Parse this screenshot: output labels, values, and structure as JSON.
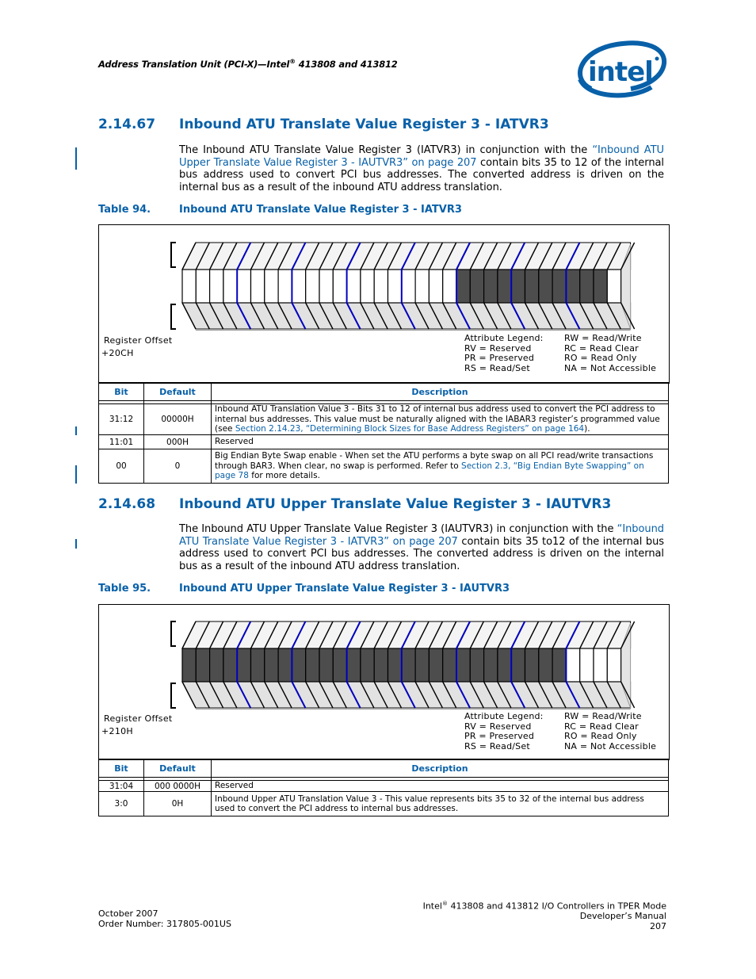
{
  "header": {
    "running_title": "Address Translation Unit (PCI-X)—Intel",
    "running_title_sup": "®",
    "running_title_tail": " 413808 and 413812",
    "logo": "intel"
  },
  "sections": [
    {
      "number": "2.14.67",
      "title": "Inbound ATU Translate Value Register 3 - IATVR3",
      "paragraph": {
        "pre": "The Inbound ATU Translate Value Register 3 (IATVR3) in conjunction with the ",
        "link": "“Inbound ATU Upper Translate Value Register 3 - IAUTVR3” on page 207",
        "post": " contain bits 35 to 12 of the internal bus address used to convert PCI bus addresses. The converted address is driven on the internal bus as a result of the inbound ATU address translation."
      },
      "table": {
        "caption_number": "Table 94.",
        "caption_title": "Inbound ATU Translate Value Register 3 - IATVR3",
        "register_offset_label": "Register Offset",
        "register_offset": "+20CH",
        "bit_shading": "wwwwwwwwwwwwwwwwwwwwdddddddddddw",
        "legend_title": "Attribute Legend:",
        "legend_left": [
          "RV = Reserved",
          "PR = Preserved",
          "RS = Read/Set"
        ],
        "legend_right": [
          "RW = Read/Write",
          "RC = Read Clear",
          "RO = Read Only",
          "NA = Not Accessible"
        ],
        "columns": [
          "Bit",
          "Default",
          "Description"
        ],
        "rows": [
          {
            "bit": "31:12",
            "default": "00000H",
            "desc_pre": "Inbound ATU Translation Value 3 - Bits 31 to 12 of internal bus address used to convert the PCI address to internal bus addresses. This value must be naturally aligned with the IABAR3 register’s programmed value (see ",
            "desc_link": "Section 2.14.23, “Determining Block Sizes for Base Address Registers” on page 164",
            "desc_post": ")."
          },
          {
            "bit": "11:01",
            "default": "000H",
            "desc_pre": "Reserved",
            "desc_link": "",
            "desc_post": ""
          },
          {
            "bit": "00",
            "default": "0",
            "desc_pre": "Big Endian Byte Swap enable - When set the ATU performs a byte swap on all PCI read/write transactions through BAR3. When clear, no swap is performed. Refer to ",
            "desc_link": "Section 2.3, “Big Endian Byte Swapping” on page 78",
            "desc_post": " for more details."
          }
        ]
      }
    },
    {
      "number": "2.14.68",
      "title": "Inbound ATU Upper Translate Value Register 3 - IAUTVR3",
      "paragraph": {
        "pre": "The Inbound ATU Upper Translate Value Register 3 (IAUTVR3) in conjunction with the ",
        "link": "“Inbound ATU Translate Value Register 3 - IATVR3” on page 207",
        "post": " contain bits 35 to12 of the internal bus address used to convert PCI bus addresses. The converted address is driven on the internal bus as a result of the inbound ATU address translation."
      },
      "table": {
        "caption_number": "Table 95.",
        "caption_title": "Inbound ATU Upper Translate Value Register 3 - IAUTVR3",
        "register_offset_label": "Register Offset",
        "register_offset": "+210H",
        "bit_shading": "ddddddddddddddddddddddddddddwwww",
        "legend_title": "Attribute Legend:",
        "legend_left": [
          "RV = Reserved",
          "PR = Preserved",
          "RS = Read/Set"
        ],
        "legend_right": [
          "RW = Read/Write",
          "RC = Read Clear",
          "RO = Read Only",
          "NA = Not Accessible"
        ],
        "columns": [
          "Bit",
          "Default",
          "Description"
        ],
        "rows": [
          {
            "bit": "31:04",
            "default": "000 0000H",
            "desc_pre": "Reserved",
            "desc_link": "",
            "desc_post": ""
          },
          {
            "bit": "3:0",
            "default": "0H",
            "desc_pre": "Inbound Upper ATU Translation Value 3 - This value represents bits 35 to 32 of the internal bus address used to convert the PCI address to internal bus addresses.",
            "desc_link": "",
            "desc_post": ""
          }
        ]
      }
    }
  ],
  "footer": {
    "date": "October 2007",
    "order_number": "Order Number: 317805-001US",
    "doc_title_pre": "Intel",
    "doc_title_sup": "®",
    "doc_title_post": " 413808 and 413812 I/O Controllers in TPER Mode",
    "doc_subtitle": "Developer’s Manual",
    "page_number": "207"
  },
  "colors": {
    "accent_blue": "#0860a8",
    "nibble_line_blue": "#0000c0",
    "dark_cell": "#4d4d4d",
    "top_face": "#f4f4f4",
    "bottom_face": "#e2e2e2"
  }
}
